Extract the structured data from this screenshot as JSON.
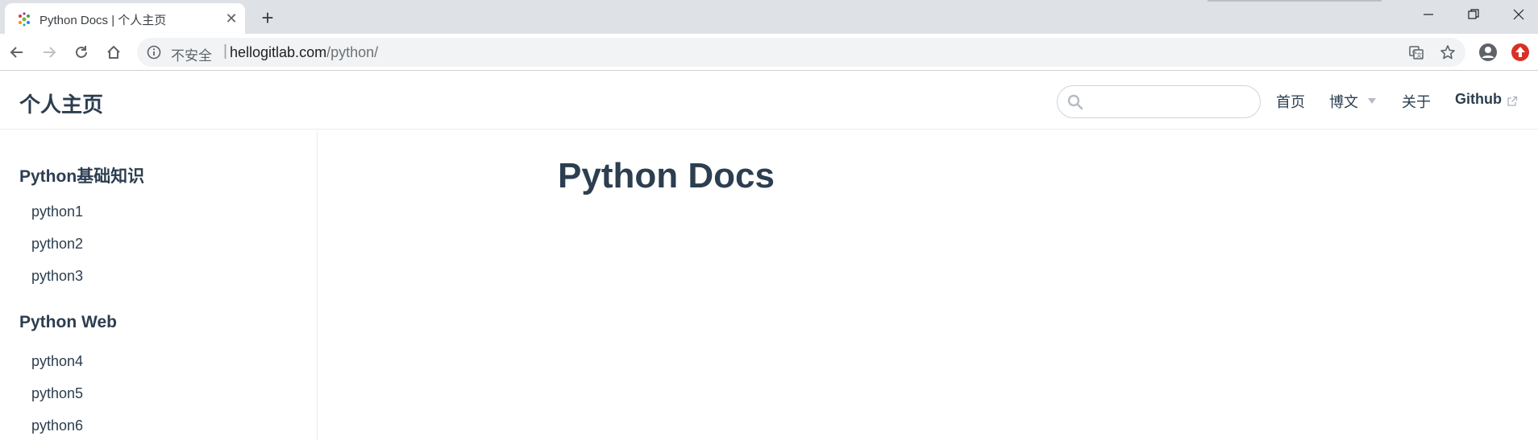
{
  "browser": {
    "tab_title": "Python Docs | 个人主页",
    "new_tab_symbol": "+",
    "close_symbol": "✕",
    "security_label": "不安全",
    "url_host": "hellogitlab.com",
    "url_path": "/python/",
    "icons": [
      "favicon-icon",
      "back-icon",
      "forward-icon",
      "reload-icon",
      "home-icon",
      "info-icon",
      "translate-icon",
      "star-icon",
      "profile-icon",
      "update-icon",
      "minimize-icon",
      "maximize-icon",
      "close-window-icon"
    ]
  },
  "header": {
    "site_title": "个人主页",
    "search_placeholder": "",
    "nav": {
      "home": "首页",
      "blog": "博文",
      "about": "关于",
      "github": "Github"
    }
  },
  "sidebar": {
    "groups": [
      {
        "title": "Python基础知识",
        "items": [
          "python1",
          "python2",
          "python3"
        ]
      },
      {
        "title": "Python Web",
        "items": [
          "python4",
          "python5",
          "python6"
        ]
      }
    ]
  },
  "main": {
    "title": "Python Docs"
  },
  "colors": {
    "text": "#2c3e50",
    "chrome_bg": "#dee1e6",
    "omnibox_bg": "#f1f3f4",
    "update_red": "#d93025"
  }
}
